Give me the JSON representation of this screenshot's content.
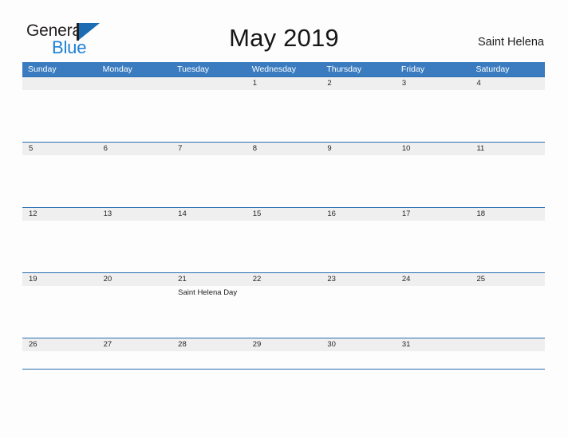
{
  "brand": {
    "line1": "General",
    "line2": "Blue",
    "flag_icon": "blue-triangle-flag-icon",
    "accent_blue": "#1c7fd4",
    "flag_blue": "#1c6cb4",
    "text_dark": "#231f20"
  },
  "header": {
    "title": "May 2019",
    "location": "Saint Helena"
  },
  "theme": {
    "header_bar_blue": "#3b7cc0",
    "rule_blue": "#2a6eb0",
    "day_band_gray": "#efefef",
    "page_background": "#fdfdfd"
  },
  "calendar": {
    "weekday_headers": [
      "Sunday",
      "Monday",
      "Tuesday",
      "Wednesday",
      "Thursday",
      "Friday",
      "Saturday"
    ],
    "weeks": [
      {
        "days": [
          "",
          "",
          "",
          "1",
          "2",
          "3",
          "4"
        ],
        "events": [
          "",
          "",
          "",
          "",
          "",
          "",
          ""
        ]
      },
      {
        "days": [
          "5",
          "6",
          "7",
          "8",
          "9",
          "10",
          "11"
        ],
        "events": [
          "",
          "",
          "",
          "",
          "",
          "",
          ""
        ]
      },
      {
        "days": [
          "12",
          "13",
          "14",
          "15",
          "16",
          "17",
          "18"
        ],
        "events": [
          "",
          "",
          "",
          "",
          "",
          "",
          ""
        ]
      },
      {
        "days": [
          "19",
          "20",
          "21",
          "22",
          "23",
          "24",
          "25"
        ],
        "events": [
          "",
          "",
          "Saint Helena Day",
          "",
          "",
          "",
          ""
        ]
      },
      {
        "days": [
          "26",
          "27",
          "28",
          "29",
          "30",
          "31",
          ""
        ],
        "events": [
          "",
          "",
          "",
          "",
          "",
          "",
          ""
        ]
      }
    ]
  }
}
